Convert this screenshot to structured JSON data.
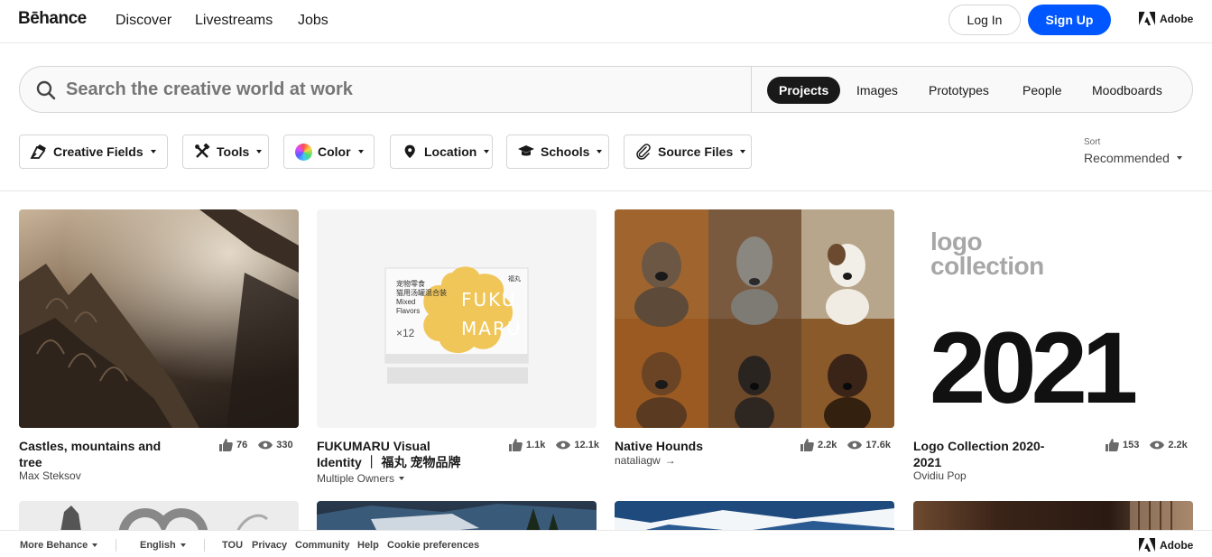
{
  "nav": {
    "logo": "Bēhance",
    "links": [
      "Discover",
      "Livestreams",
      "Jobs"
    ],
    "login": "Log In",
    "signup": "Sign Up",
    "adobe": "Adobe",
    "signup_color": "#0057ff"
  },
  "search": {
    "placeholder": "Search the creative world at work",
    "tabs": [
      "Projects",
      "Images",
      "Prototypes",
      "People",
      "Moodboards"
    ],
    "active_tab": "Projects"
  },
  "filters": [
    {
      "label": "Creative Fields",
      "icon": "pen-nib-icon"
    },
    {
      "label": "Tools",
      "icon": "tools-icon"
    },
    {
      "label": "Color",
      "icon": "color-wheel-icon"
    },
    {
      "label": "Location",
      "icon": "location-pin-icon"
    },
    {
      "label": "Schools",
      "icon": "graduation-cap-icon"
    },
    {
      "label": "Source Files",
      "icon": "paperclip-icon"
    }
  ],
  "sort": {
    "label": "Sort",
    "value": "Recommended"
  },
  "projects": [
    {
      "title_lines": [
        "Castles, mountains and",
        "tree"
      ],
      "owner": "Max Steksov",
      "likes": "76",
      "views": "330"
    },
    {
      "title_lines": [
        "FUKUMARU Visual",
        "Identity ｜ 福丸 宠物品牌"
      ],
      "owner": "Multiple Owners",
      "likes": "1.1k",
      "views": "12.1k"
    },
    {
      "title_lines": [
        "Native Hounds"
      ],
      "owner": "nataliagw",
      "likes": "2.2k",
      "views": "17.6k"
    },
    {
      "title_lines": [
        "Logo Collection 2020-",
        "2021"
      ],
      "owner": "Ovidiu Pop",
      "likes": "153",
      "views": "2.2k"
    }
  ],
  "artwork": {
    "fukumaru_box": {
      "line1": "宠物零食",
      "line2": "猫用汤罐混合装",
      "line3": "Mixed",
      "line4": "Flavors",
      "count": "×12",
      "brand_kanji": "福丸",
      "brand_top": "FUKU",
      "brand_bottom": "MARU"
    },
    "logo_collection": {
      "line1": "logo",
      "line2": "collection",
      "big": "2021"
    }
  },
  "footer": {
    "more": "More Behance",
    "language": "English",
    "links": [
      "TOU",
      "Privacy",
      "Community",
      "Help",
      "Cookie preferences"
    ],
    "adobe": "Adobe"
  }
}
